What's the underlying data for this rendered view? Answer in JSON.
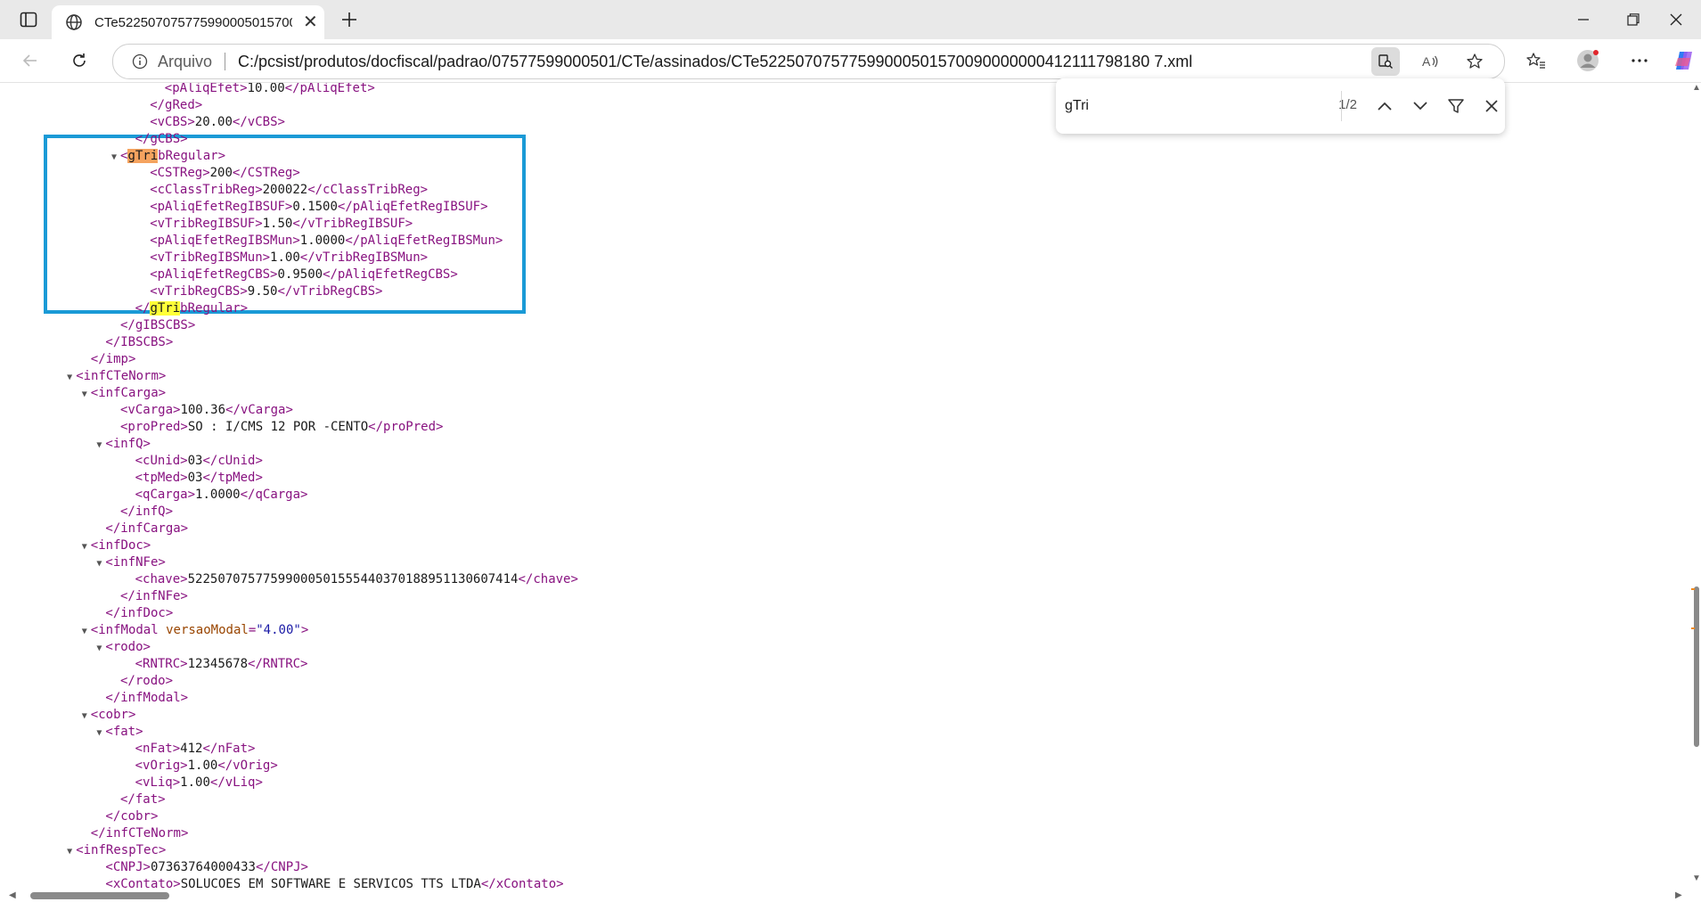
{
  "browser": {
    "tab_title": "CTe52250707577599000501570090000000412111798180 7.xml",
    "address_scheme": "Arquivo",
    "address_url": "C:/pcsist/produtos/docfiscal/padrao/07577599000501/CTe/assinados/CTe52250707577599000501570090000000412111798180 7.xml"
  },
  "find": {
    "query": "gTri",
    "count": "1/2"
  },
  "xml_lines": [
    {
      "indent": 8,
      "tog": "",
      "html": "<span class=\"tag\">&lt;pAliqEfet&gt;</span>10.00<span class=\"tag\">&lt;/pAliqEfet&gt;</span>"
    },
    {
      "indent": 7,
      "tog": "",
      "html": "<span class=\"tag\">&lt;/gRed&gt;</span>"
    },
    {
      "indent": 7,
      "tog": "",
      "html": "<span class=\"tag\">&lt;vCBS&gt;</span>20.00<span class=\"tag\">&lt;/vCBS&gt;</span>"
    },
    {
      "indent": 6,
      "tog": "",
      "html": "<span class=\"tag\">&lt;/gCBS&gt;</span>"
    },
    {
      "indent": 5,
      "tog": "▼",
      "html": "<span class=\"tag\">&lt;</span><span class=\"tag hl-active\">gTri</span><span class=\"tag\">bRegular&gt;</span>"
    },
    {
      "indent": 7,
      "tog": "",
      "html": "<span class=\"tag\">&lt;CSTReg&gt;</span>200<span class=\"tag\">&lt;/CSTReg&gt;</span>"
    },
    {
      "indent": 7,
      "tog": "",
      "html": "<span class=\"tag\">&lt;cClassTribReg&gt;</span>200022<span class=\"tag\">&lt;/cClassTribReg&gt;</span>"
    },
    {
      "indent": 7,
      "tog": "",
      "html": "<span class=\"tag\">&lt;pAliqEfetRegIBSUF&gt;</span>0.1500<span class=\"tag\">&lt;/pAliqEfetRegIBSUF&gt;</span>"
    },
    {
      "indent": 7,
      "tog": "",
      "html": "<span class=\"tag\">&lt;vTribRegIBSUF&gt;</span>1.50<span class=\"tag\">&lt;/vTribRegIBSUF&gt;</span>"
    },
    {
      "indent": 7,
      "tog": "",
      "html": "<span class=\"tag\">&lt;pAliqEfetRegIBSMun&gt;</span>1.0000<span class=\"tag\">&lt;/pAliqEfetRegIBSMun&gt;</span>"
    },
    {
      "indent": 7,
      "tog": "",
      "html": "<span class=\"tag\">&lt;vTribRegIBSMun&gt;</span>1.00<span class=\"tag\">&lt;/vTribRegIBSMun&gt;</span>"
    },
    {
      "indent": 7,
      "tog": "",
      "html": "<span class=\"tag\">&lt;pAliqEfetRegCBS&gt;</span>0.9500<span class=\"tag\">&lt;/pAliqEfetRegCBS&gt;</span>"
    },
    {
      "indent": 7,
      "tog": "",
      "html": "<span class=\"tag\">&lt;vTribRegCBS&gt;</span>9.50<span class=\"tag\">&lt;/vTribRegCBS&gt;</span>"
    },
    {
      "indent": 6,
      "tog": "",
      "html": "<span class=\"tag\">&lt;/</span><span class=\"tag hl-match\">gTri</span><span class=\"tag\">bRegular&gt;</span>"
    },
    {
      "indent": 5,
      "tog": "",
      "html": "<span class=\"tag\">&lt;/gIBSCBS&gt;</span>"
    },
    {
      "indent": 4,
      "tog": "",
      "html": "<span class=\"tag\">&lt;/IBSCBS&gt;</span>"
    },
    {
      "indent": 3,
      "tog": "",
      "html": "<span class=\"tag\">&lt;/imp&gt;</span>"
    },
    {
      "indent": 2,
      "tog": "▼",
      "html": "<span class=\"tag\">&lt;infCTeNorm&gt;</span>"
    },
    {
      "indent": 3,
      "tog": "▼",
      "html": "<span class=\"tag\">&lt;infCarga&gt;</span>"
    },
    {
      "indent": 5,
      "tog": "",
      "html": "<span class=\"tag\">&lt;vCarga&gt;</span>100.36<span class=\"tag\">&lt;/vCarga&gt;</span>"
    },
    {
      "indent": 5,
      "tog": "",
      "html": "<span class=\"tag\">&lt;proPred&gt;</span>SO : I/CMS 12 POR -CENTO<span class=\"tag\">&lt;/proPred&gt;</span>"
    },
    {
      "indent": 4,
      "tog": "▼",
      "html": "<span class=\"tag\">&lt;infQ&gt;</span>"
    },
    {
      "indent": 6,
      "tog": "",
      "html": "<span class=\"tag\">&lt;cUnid&gt;</span>03<span class=\"tag\">&lt;/cUnid&gt;</span>"
    },
    {
      "indent": 6,
      "tog": "",
      "html": "<span class=\"tag\">&lt;tpMed&gt;</span>03<span class=\"tag\">&lt;/tpMed&gt;</span>"
    },
    {
      "indent": 6,
      "tog": "",
      "html": "<span class=\"tag\">&lt;qCarga&gt;</span>1.0000<span class=\"tag\">&lt;/qCarga&gt;</span>"
    },
    {
      "indent": 5,
      "tog": "",
      "html": "<span class=\"tag\">&lt;/infQ&gt;</span>"
    },
    {
      "indent": 4,
      "tog": "",
      "html": "<span class=\"tag\">&lt;/infCarga&gt;</span>"
    },
    {
      "indent": 3,
      "tog": "▼",
      "html": "<span class=\"tag\">&lt;infDoc&gt;</span>"
    },
    {
      "indent": 4,
      "tog": "▼",
      "html": "<span class=\"tag\">&lt;infNFe&gt;</span>"
    },
    {
      "indent": 6,
      "tog": "",
      "html": "<span class=\"tag\">&lt;chave&gt;</span>52250707577599000501555440370188951130607414<span class=\"tag\">&lt;/chave&gt;</span>"
    },
    {
      "indent": 5,
      "tog": "",
      "html": "<span class=\"tag\">&lt;/infNFe&gt;</span>"
    },
    {
      "indent": 4,
      "tog": "",
      "html": "<span class=\"tag\">&lt;/infDoc&gt;</span>"
    },
    {
      "indent": 3,
      "tog": "▼",
      "html": "<span class=\"tag\">&lt;infModal </span><span class=\"attr-name\">versaoModal</span><span class=\"tag\">=</span><span class=\"attr-val\">\"4.00\"</span><span class=\"tag\">&gt;</span>"
    },
    {
      "indent": 4,
      "tog": "▼",
      "html": "<span class=\"tag\">&lt;rodo&gt;</span>"
    },
    {
      "indent": 6,
      "tog": "",
      "html": "<span class=\"tag\">&lt;RNTRC&gt;</span>12345678<span class=\"tag\">&lt;/RNTRC&gt;</span>"
    },
    {
      "indent": 5,
      "tog": "",
      "html": "<span class=\"tag\">&lt;/rodo&gt;</span>"
    },
    {
      "indent": 4,
      "tog": "",
      "html": "<span class=\"tag\">&lt;/infModal&gt;</span>"
    },
    {
      "indent": 3,
      "tog": "▼",
      "html": "<span class=\"tag\">&lt;cobr&gt;</span>"
    },
    {
      "indent": 4,
      "tog": "▼",
      "html": "<span class=\"tag\">&lt;fat&gt;</span>"
    },
    {
      "indent": 6,
      "tog": "",
      "html": "<span class=\"tag\">&lt;nFat&gt;</span>412<span class=\"tag\">&lt;/nFat&gt;</span>"
    },
    {
      "indent": 6,
      "tog": "",
      "html": "<span class=\"tag\">&lt;vOrig&gt;</span>1.00<span class=\"tag\">&lt;/vOrig&gt;</span>"
    },
    {
      "indent": 6,
      "tog": "",
      "html": "<span class=\"tag\">&lt;vLiq&gt;</span>1.00<span class=\"tag\">&lt;/vLiq&gt;</span>"
    },
    {
      "indent": 5,
      "tog": "",
      "html": "<span class=\"tag\">&lt;/fat&gt;</span>"
    },
    {
      "indent": 4,
      "tog": "",
      "html": "<span class=\"tag\">&lt;/cobr&gt;</span>"
    },
    {
      "indent": 3,
      "tog": "",
      "html": "<span class=\"tag\">&lt;/infCTeNorm&gt;</span>"
    },
    {
      "indent": 2,
      "tog": "▼",
      "html": "<span class=\"tag\">&lt;infRespTec&gt;</span>"
    },
    {
      "indent": 4,
      "tog": "",
      "html": "<span class=\"tag\">&lt;CNPJ&gt;</span>07363764000433<span class=\"tag\">&lt;/CNPJ&gt;</span>"
    },
    {
      "indent": 4,
      "tog": "",
      "html": "<span class=\"tag\">&lt;xContato&gt;</span>SOLUCOES EM SOFTWARE E SERVICOS TTS LTDA<span class=\"tag\">&lt;/xContato&gt;</span>"
    }
  ]
}
